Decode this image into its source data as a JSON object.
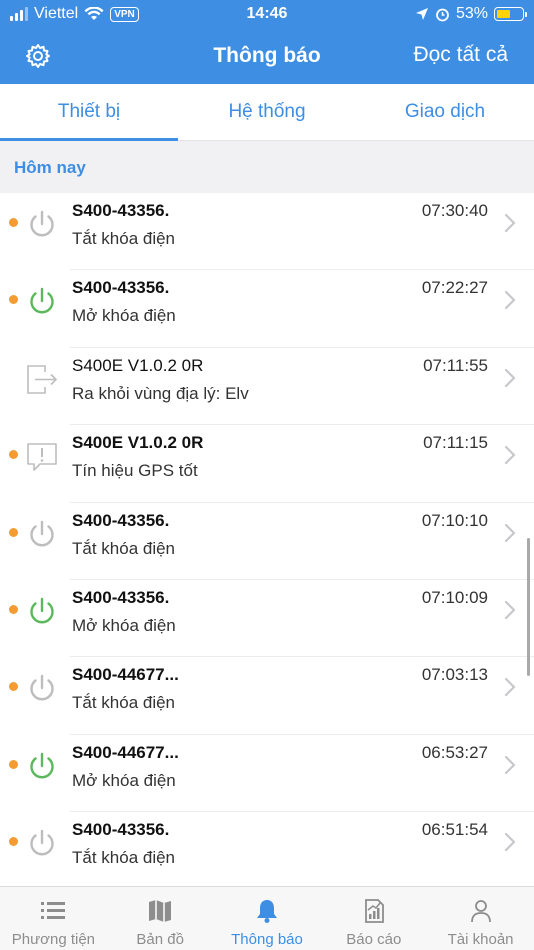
{
  "status_bar": {
    "carrier": "Viettel",
    "vpn": "VPN",
    "time": "14:46",
    "battery": "53%",
    "battery_level": 0.53
  },
  "header": {
    "title": "Thông báo",
    "read_all": "Đọc tất cả"
  },
  "tabs": [
    {
      "label": "Thiết bị",
      "active": true
    },
    {
      "label": "Hệ thống",
      "active": false
    },
    {
      "label": "Giao dịch",
      "active": false
    }
  ],
  "section": {
    "title": "Hôm nay"
  },
  "notifications": [
    {
      "name": "S400-43356.",
      "desc": "Tắt khóa điện",
      "time": "07:30:40",
      "icon": "power-off-icon",
      "unread": true
    },
    {
      "name": "S400-43356.",
      "desc": "Mở khóa điện",
      "time": "07:22:27",
      "icon": "power-on-icon",
      "unread": true
    },
    {
      "name": "S400E V1.0.2 0R",
      "desc": "Ra khỏi vùng địa lý: Elv",
      "time": "07:11:55",
      "icon": "exit-zone-icon",
      "unread": false
    },
    {
      "name": "S400E V1.0.2 0R",
      "desc": "Tín hiệu GPS tốt",
      "time": "07:11:15",
      "icon": "message-alert-icon",
      "unread": true
    },
    {
      "name": "S400-43356.",
      "desc": "Tắt khóa điện",
      "time": "07:10:10",
      "icon": "power-off-icon",
      "unread": true
    },
    {
      "name": "S400-43356.",
      "desc": "Mở khóa điện",
      "time": "07:10:09",
      "icon": "power-on-icon",
      "unread": true
    },
    {
      "name": "S400-44677...",
      "desc": "Tắt khóa điện",
      "time": "07:03:13",
      "icon": "power-off-icon",
      "unread": true
    },
    {
      "name": "S400-44677...",
      "desc": "Mở khóa điện",
      "time": "06:53:27",
      "icon": "power-on-icon",
      "unread": true
    },
    {
      "name": "S400-43356.",
      "desc": "Tắt khóa điện",
      "time": "06:51:54",
      "icon": "power-off-icon",
      "unread": true
    }
  ],
  "bottom_nav": [
    {
      "label": "Phương tiện",
      "icon": "list-icon",
      "active": false
    },
    {
      "label": "Bản đồ",
      "icon": "map-icon",
      "active": false
    },
    {
      "label": "Thông báo",
      "icon": "bell-icon",
      "active": true
    },
    {
      "label": "Báo cáo",
      "icon": "report-icon",
      "active": false
    },
    {
      "label": "Tài khoản",
      "icon": "user-icon",
      "active": false
    }
  ],
  "colors": {
    "primary": "#3e8ee3",
    "unread_dot": "#f39c32",
    "power_on": "#5cb85c",
    "power_off": "#bdbdbd"
  }
}
